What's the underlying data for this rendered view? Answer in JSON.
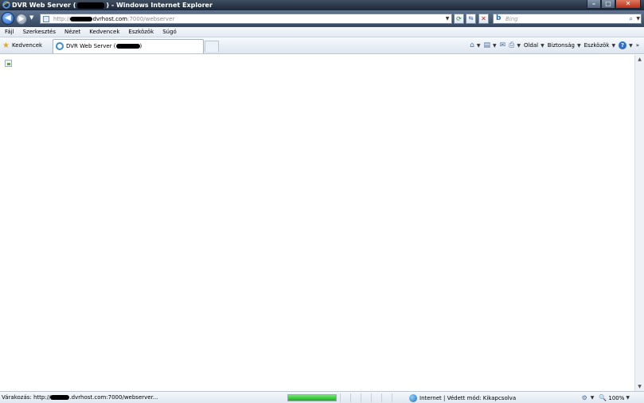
{
  "window": {
    "title_prefix": "DVR Web Server (",
    "title_suffix": ") - Windows Internet Explorer",
    "controls": {
      "minimize": "–",
      "maximize": "□",
      "close": "✕"
    }
  },
  "nav": {
    "back_glyph": "◀",
    "forward_glyph": "▶",
    "address_prefix": "http://",
    "address_host": "dvrhost.com",
    "address_path": ":7000/webserver",
    "search_placeholder": "Bing",
    "icons": [
      "back-arrow-icon",
      "forward-arrow-icon",
      "refresh-icon",
      "compat-view-icon",
      "stop-icon",
      "bing-icon",
      "search-icon"
    ]
  },
  "menu": [
    "Fájl",
    "Szerkesztés",
    "Nézet",
    "Kedvencek",
    "Eszközök",
    "Súgó"
  ],
  "favorites_label": "Kedvencek",
  "tab": {
    "label_prefix": "DVR Web Server (",
    "label_suffix": ")"
  },
  "command_bar": {
    "page": "Oldal",
    "safety": "Biztonság",
    "tools": "Eszközök",
    "help": "?",
    "overflow": "»"
  },
  "status": {
    "text_prefix": "Várakozás: http://",
    "text_suffix": ".dvrhost.com:7000/webserver...",
    "progress_percent": 100,
    "zone": "Internet | Védett mód: Kikapcsolva",
    "zoom": "100%"
  },
  "colors": {
    "progress": "#14b514",
    "accent": "#2d6fc6"
  }
}
